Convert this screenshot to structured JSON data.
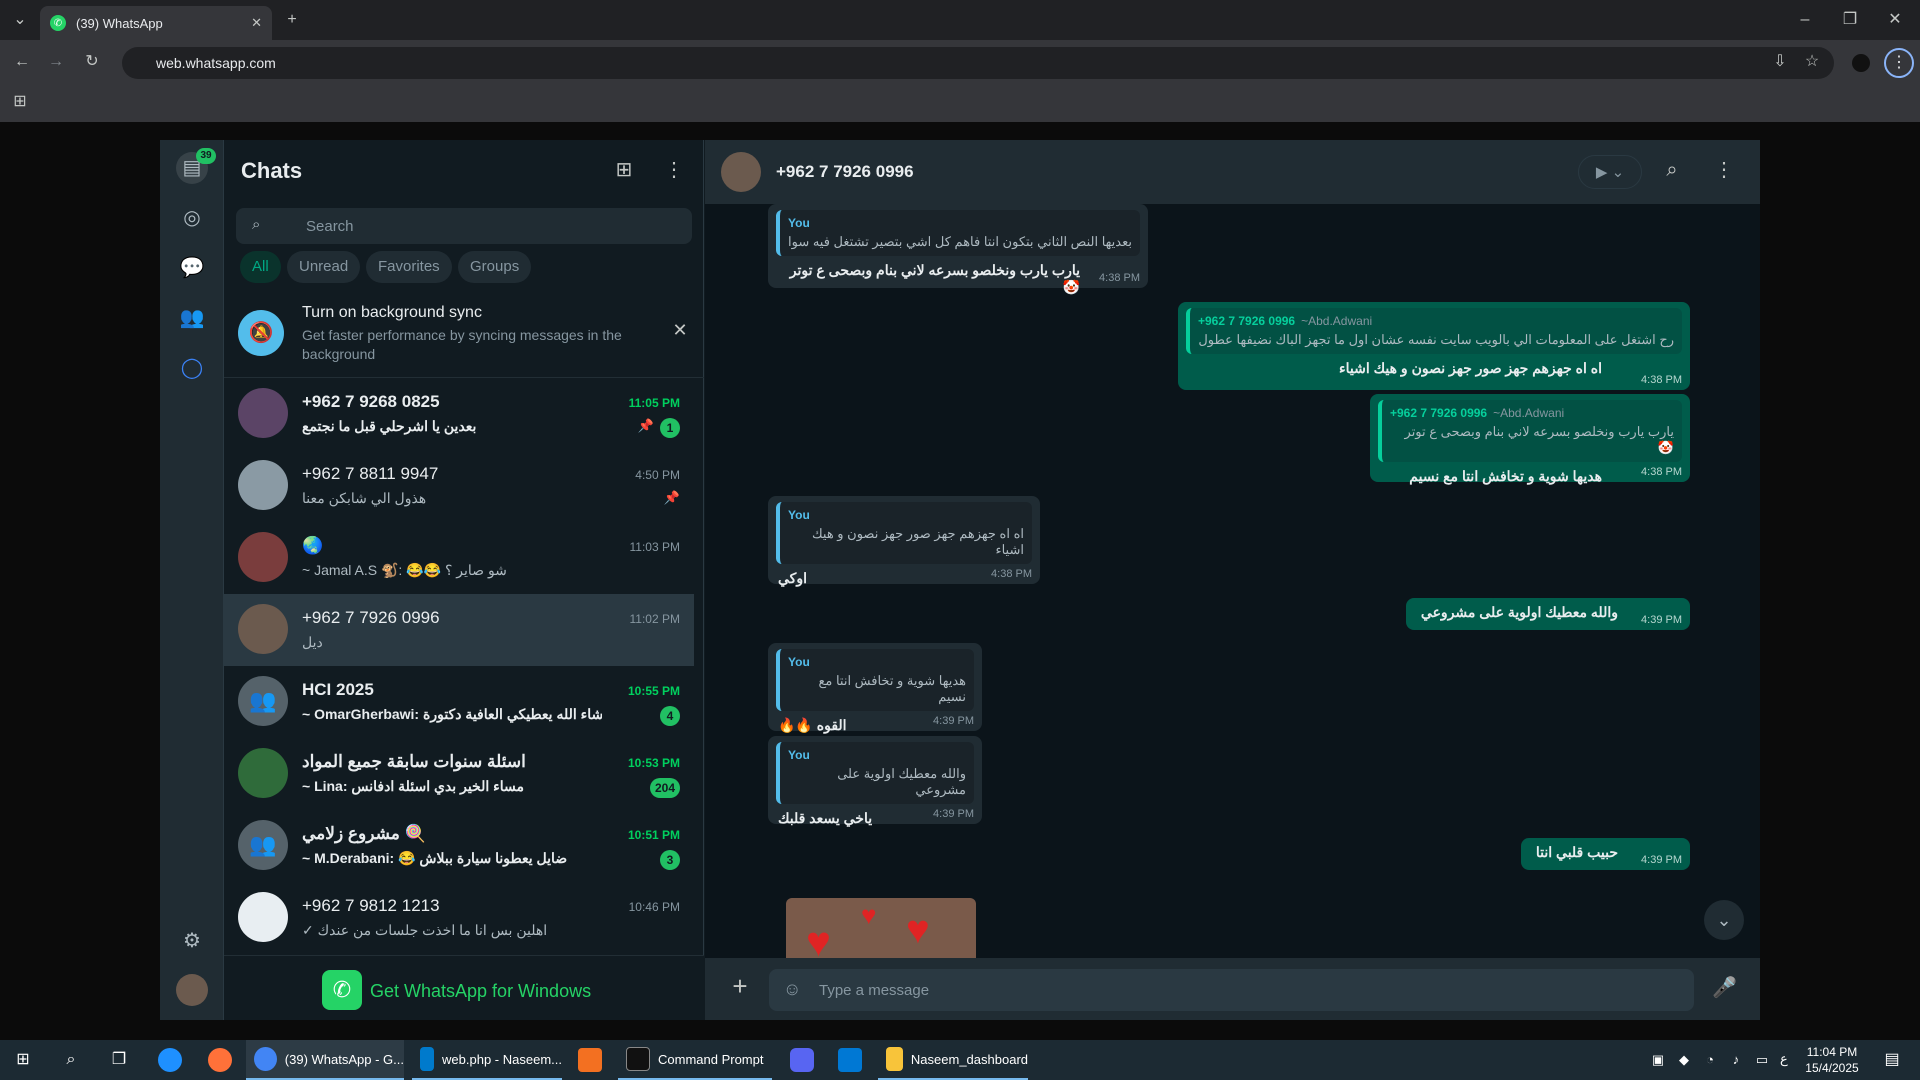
{
  "browser": {
    "tab_title": "(39) WhatsApp",
    "url": "web.whatsapp.com"
  },
  "rail": {
    "chats_badge": "39"
  },
  "sidebar": {
    "title": "Chats",
    "search_placeholder": "Search",
    "filters": [
      "All",
      "Unread",
      "Favorites",
      "Groups"
    ],
    "sync": {
      "title": "Turn on background sync",
      "text": "Get faster performance by syncing messages in the background"
    },
    "get_app": "Get WhatsApp for Windows",
    "chats": [
      {
        "name": "+962 7 9268 0825",
        "preview": "بعدين يا اشرحلي قبل ما نجتمع",
        "time": "11:05 PM",
        "badge": "1",
        "pinned": true,
        "unread": true
      },
      {
        "name": "+962 7 8811 9947",
        "preview": "هذول الي شابكن معنا",
        "time": "4:50 PM",
        "badge": "",
        "pinned": true,
        "unread": false
      },
      {
        "name": "🌏",
        "preview": "~ Jamal A.S 🐒: 😂😂 شو صاير ؟",
        "time": "11:03 PM",
        "badge": "",
        "pinned": false,
        "unread": false
      },
      {
        "name": "+962 7 7926 0996",
        "preview": "ديل",
        "time": "11:02 PM",
        "badge": "",
        "pinned": false,
        "unread": false
      },
      {
        "name": "HCI 2025",
        "preview": "~ OmarGherbawi: ان شاء الله يعطيكي العافية دكتورة",
        "time": "10:55 PM",
        "badge": "4",
        "pinned": false,
        "unread": true
      },
      {
        "name": "اسئلة سنوات سابقة جميع المواد",
        "preview": "~ Lina: مساء الخير بدي اسئلة ادفانس",
        "time": "10:53 PM",
        "badge": "204",
        "pinned": false,
        "unread": true
      },
      {
        "name": "مشروع زلامي 🍭",
        "preview": "~ M.Derabani: 😂 ضايل يعطونا سيارة ببلاش",
        "time": "10:51 PM",
        "badge": "3",
        "pinned": false,
        "unread": true
      },
      {
        "name": "+962 7 9812 1213",
        "preview": "✓ اهلين بس انا ما اخذت جلسات من عندك",
        "time": "10:46 PM",
        "badge": "",
        "pinned": false,
        "unread": false
      }
    ]
  },
  "conversation": {
    "contact": "+962 7 7926 0996",
    "input_placeholder": "Type a message",
    "messages": [
      {
        "dir": "in",
        "q_author": "You",
        "q_sub": "",
        "q_text": "بعديها النص الثاني بتكون انتا فاهم كل اشي بتصير تشتغل فيه سوا",
        "text": "يارب يارب ونخلصو بسرعه لاني بنام وبصحى ع توتر 🤡",
        "time": "4:38 PM"
      },
      {
        "dir": "out",
        "q_author": "+962 7 7926 0996",
        "q_sub": "~Abd.Adwani",
        "q_text": "رح اشتغل على المعلومات الي بالويب سايت نفسه عشان اول ما تجهز الباك نضيفها عطول",
        "text": "اه اه جهزهم جهز صور جهز نصون و هيك اشياء",
        "time": "4:38 PM"
      },
      {
        "dir": "out",
        "q_author": "+962 7 7926 0996",
        "q_sub": "~Abd.Adwani",
        "q_text": "يارب يارب ونخلصو بسرعه لاني بنام وبصحى ع توتر 🤡",
        "text": "هديها شوية و تخافش انتا مع نسيم",
        "time": "4:38 PM"
      },
      {
        "dir": "in",
        "q_author": "You",
        "q_sub": "",
        "q_text": "اه اه جهزهم جهز صور جهز نصون و هيك اشياء",
        "text": "اوكي",
        "time": "4:38 PM"
      },
      {
        "dir": "out",
        "q_author": "",
        "q_sub": "",
        "q_text": "",
        "text": "والله معطيك اولوية على مشروعي",
        "time": "4:39 PM"
      },
      {
        "dir": "in",
        "q_author": "You",
        "q_sub": "",
        "q_text": "هديها شوية و تخافش انتا مع نسيم",
        "text": "القوه 🔥🔥",
        "time": "4:39 PM"
      },
      {
        "dir": "in",
        "q_author": "You",
        "q_sub": "",
        "q_text": "والله معطيك اولوية على مشروعي",
        "text": "ياخي يسعد قلبك",
        "time": "4:39 PM"
      },
      {
        "dir": "out",
        "q_author": "",
        "q_sub": "",
        "q_text": "",
        "text": "حبيب قلبي انتا",
        "time": "4:39 PM"
      }
    ]
  },
  "taskbar": {
    "items": [
      "(39) WhatsApp - G...",
      "web.php - Naseem...",
      "Command Prompt",
      "Naseem_dashboard"
    ],
    "time": "11:04 PM",
    "date": "15/4/2025",
    "lang": "ع"
  }
}
